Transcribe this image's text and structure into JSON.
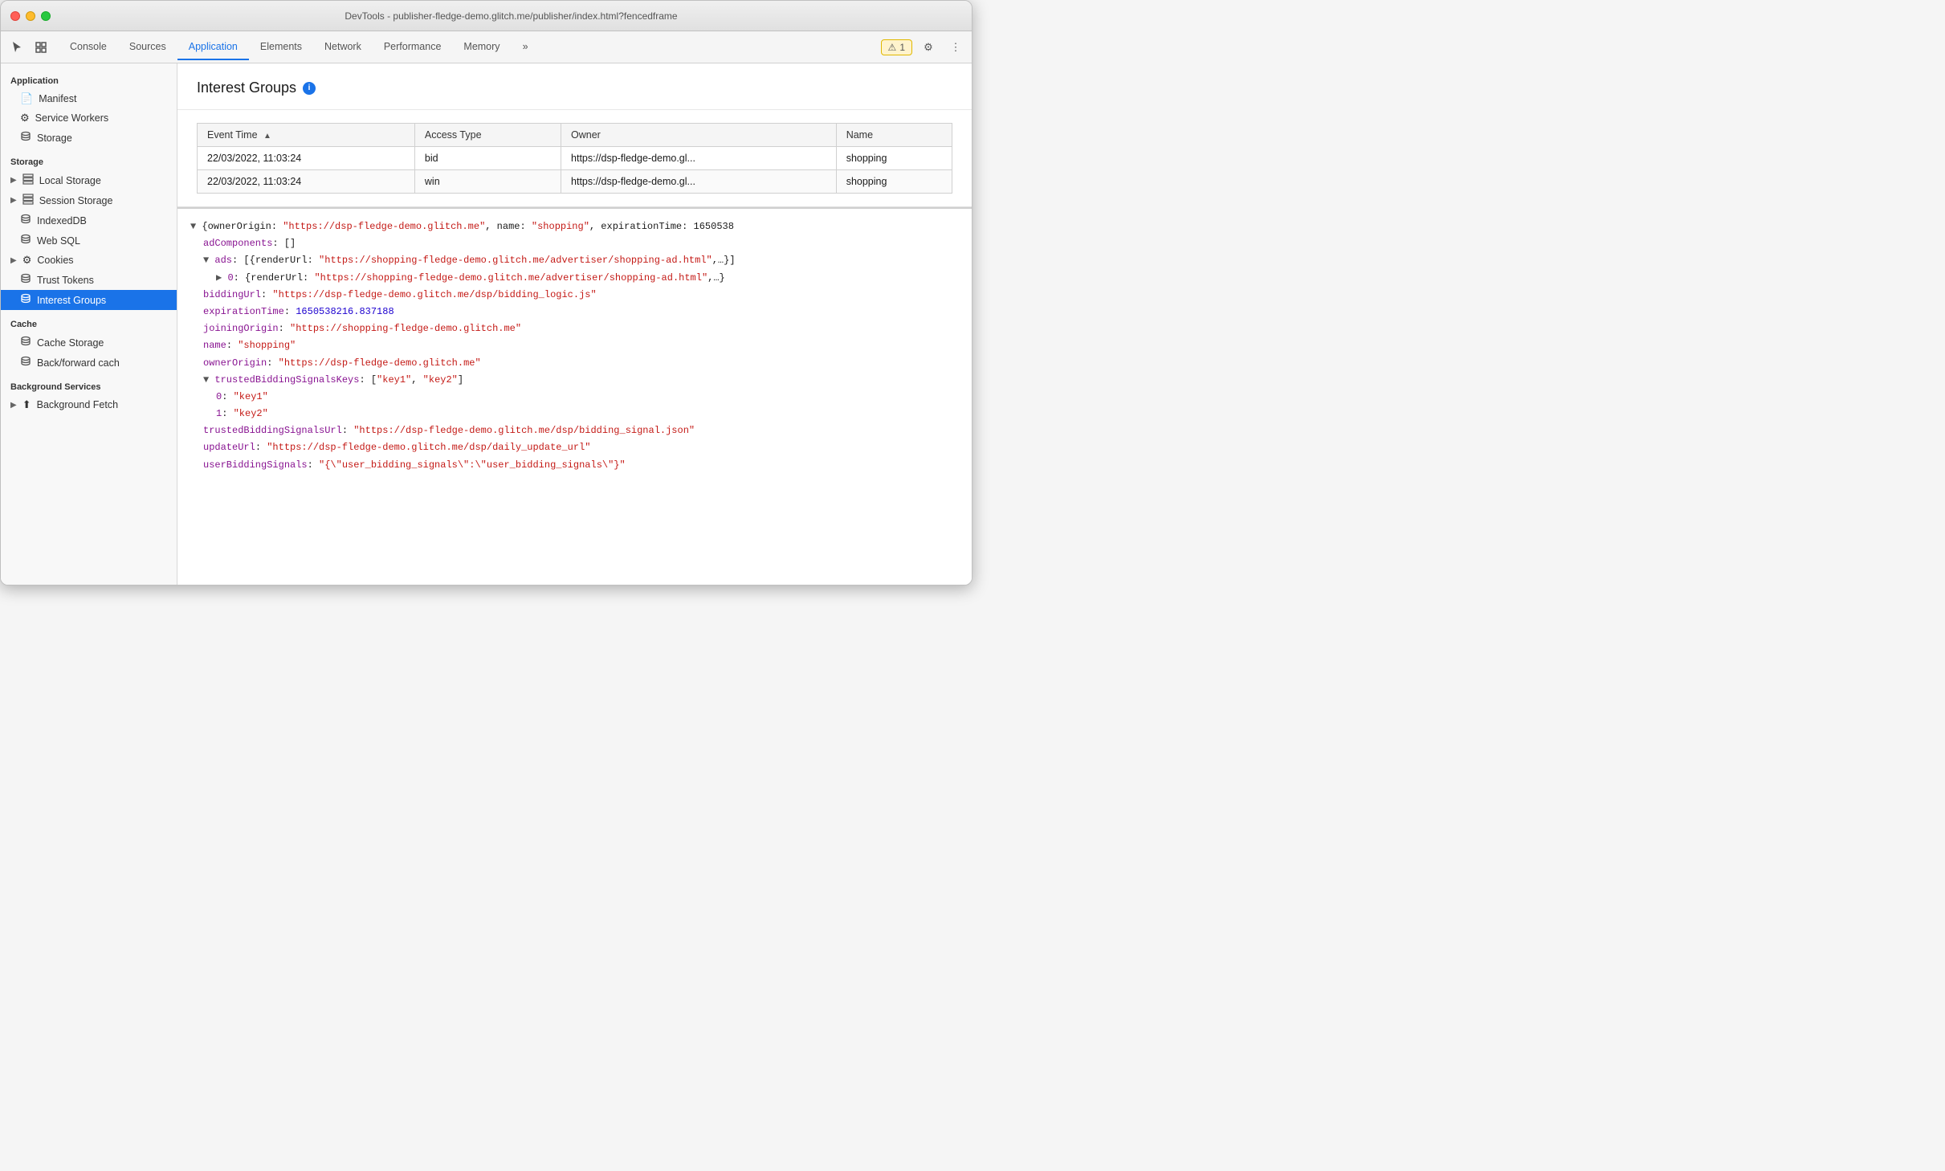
{
  "window": {
    "title": "DevTools - publisher-fledge-demo.glitch.me/publisher/index.html?fencedframe"
  },
  "toolbar": {
    "tabs": [
      {
        "id": "console",
        "label": "Console",
        "active": false
      },
      {
        "id": "sources",
        "label": "Sources",
        "active": false
      },
      {
        "id": "application",
        "label": "Application",
        "active": true
      },
      {
        "id": "elements",
        "label": "Elements",
        "active": false
      },
      {
        "id": "network",
        "label": "Network",
        "active": false
      },
      {
        "id": "performance",
        "label": "Performance",
        "active": false
      },
      {
        "id": "memory",
        "label": "Memory",
        "active": false
      }
    ],
    "more_label": "»",
    "warning_count": "1",
    "settings_icon": "⚙",
    "more_options_icon": "⋮"
  },
  "sidebar": {
    "sections": [
      {
        "id": "application",
        "header": "Application",
        "items": [
          {
            "id": "manifest",
            "label": "Manifest",
            "icon": "📄",
            "type": "item"
          },
          {
            "id": "service-workers",
            "label": "Service Workers",
            "icon": "⚙",
            "type": "item"
          },
          {
            "id": "storage",
            "label": "Storage",
            "icon": "🗄",
            "type": "item"
          }
        ]
      },
      {
        "id": "storage",
        "header": "Storage",
        "items": [
          {
            "id": "local-storage",
            "label": "Local Storage",
            "icon": "▶",
            "type": "expandable",
            "icon2": "⊞"
          },
          {
            "id": "session-storage",
            "label": "Session Storage",
            "icon": "▶",
            "type": "expandable",
            "icon2": "⊞"
          },
          {
            "id": "indexeddb",
            "label": "IndexedDB",
            "icon": "🗄",
            "type": "item"
          },
          {
            "id": "web-sql",
            "label": "Web SQL",
            "icon": "🗄",
            "type": "item"
          },
          {
            "id": "cookies",
            "label": "Cookies",
            "icon": "▶",
            "type": "expandable",
            "icon2": "🍪"
          },
          {
            "id": "trust-tokens",
            "label": "Trust Tokens",
            "icon": "🗄",
            "type": "item"
          },
          {
            "id": "interest-groups",
            "label": "Interest Groups",
            "icon": "🗄",
            "type": "item",
            "active": true
          }
        ]
      },
      {
        "id": "cache",
        "header": "Cache",
        "items": [
          {
            "id": "cache-storage",
            "label": "Cache Storage",
            "icon": "🗄",
            "type": "item"
          },
          {
            "id": "back-forward-cache",
            "label": "Back/forward cach",
            "icon": "🗄",
            "type": "item"
          }
        ]
      },
      {
        "id": "background-services",
        "header": "Background Services",
        "items": [
          {
            "id": "background-fetch",
            "label": "Background Fetch",
            "icon": "▶",
            "type": "expandable-arrow"
          }
        ]
      }
    ]
  },
  "interest_groups": {
    "title": "Interest Groups",
    "table": {
      "columns": [
        {
          "id": "event-time",
          "label": "Event Time",
          "sortable": true
        },
        {
          "id": "access-type",
          "label": "Access Type"
        },
        {
          "id": "owner",
          "label": "Owner"
        },
        {
          "id": "name",
          "label": "Name"
        }
      ],
      "rows": [
        {
          "event_time": "22/03/2022, 11:03:24",
          "access_type": "bid",
          "owner": "https://dsp-fledge-demo.gl...",
          "name": "shopping"
        },
        {
          "event_time": "22/03/2022, 11:03:24",
          "access_type": "win",
          "owner": "https://dsp-fledge-demo.gl...",
          "name": "shopping"
        }
      ]
    },
    "detail": {
      "lines": [
        {
          "indent": 0,
          "content": "▼ {ownerOrigin: \"https://dsp-fledge-demo.glitch.me\", name: \"shopping\", expirationTime: 1650538",
          "type": "plain"
        },
        {
          "indent": 1,
          "content": "adComponents: []",
          "key": "adComponents",
          "value": "[]",
          "type": "keyval"
        },
        {
          "indent": 1,
          "content": "▼ ads: [{renderUrl: \"https://shopping-fledge-demo.glitch.me/advertiser/shopping-ad.html\",…}]",
          "type": "expand"
        },
        {
          "indent": 2,
          "content": "▶ 0: {renderUrl: \"https://shopping-fledge-demo.glitch.me/advertiser/shopping-ad.html\",…}",
          "type": "expand"
        },
        {
          "indent": 1,
          "content": "biddingUrl: \"https://dsp-fledge-demo.glitch.me/dsp/bidding_logic.js\"",
          "key": "biddingUrl",
          "value": "\"https://dsp-fledge-demo.glitch.me/dsp/bidding_logic.js\"",
          "type": "keyval-red"
        },
        {
          "indent": 1,
          "content": "expirationTime: 1650538216.837188",
          "key": "expirationTime",
          "value": "1650538216.837188",
          "type": "keyval-num"
        },
        {
          "indent": 1,
          "content": "joiningOrigin: \"https://shopping-fledge-demo.glitch.me\"",
          "key": "joiningOrigin",
          "value": "\"https://shopping-fledge-demo.glitch.me\"",
          "type": "keyval-red"
        },
        {
          "indent": 1,
          "content": "name: \"shopping\"",
          "key": "name",
          "value": "\"shopping\"",
          "type": "keyval-red"
        },
        {
          "indent": 1,
          "content": "ownerOrigin: \"https://dsp-fledge-demo.glitch.me\"",
          "key": "ownerOrigin",
          "value": "\"https://dsp-fledge-demo.glitch.me\"",
          "type": "keyval-red"
        },
        {
          "indent": 1,
          "content": "▼ trustedBiddingSignalsKeys: [\"key1\", \"key2\"]",
          "type": "expand"
        },
        {
          "indent": 2,
          "content": "0: \"key1\"",
          "key": "0",
          "value": "\"key1\"",
          "type": "keyval-red"
        },
        {
          "indent": 2,
          "content": "1: \"key2\"",
          "key": "1",
          "value": "\"key2\"",
          "type": "keyval-red"
        },
        {
          "indent": 1,
          "content": "trustedBiddingSignalsUrl: \"https://dsp-fledge-demo.glitch.me/dsp/bidding_signal.json\"",
          "key": "trustedBiddingSignalsUrl",
          "value": "\"https://dsp-fledge-demo.glitch.me/dsp/bidding_signal.json\"",
          "type": "keyval-red"
        },
        {
          "indent": 1,
          "content": "updateUrl: \"https://dsp-fledge-demo.glitch.me/dsp/daily_update_url\"",
          "key": "updateUrl",
          "value": "\"https://dsp-fledge-demo.glitch.me/dsp/daily_update_url\"",
          "type": "keyval-red"
        },
        {
          "indent": 1,
          "content": "userBiddingSignals: \"{\\\"user_bidding_signals\\\":\\\"user_bidding_signals\\\"}\"",
          "key": "userBiddingSignals",
          "value": "\"{\\\"user_bidding_signals\\\":\\\"user_bidding_signals\\\"}\"",
          "type": "keyval-red"
        }
      ]
    }
  },
  "colors": {
    "accent": "#1a73e8",
    "active_sidebar_bg": "#1a73e8",
    "key_color": "#881391",
    "string_color": "#c41a16",
    "num_color": "#1c00cf"
  }
}
